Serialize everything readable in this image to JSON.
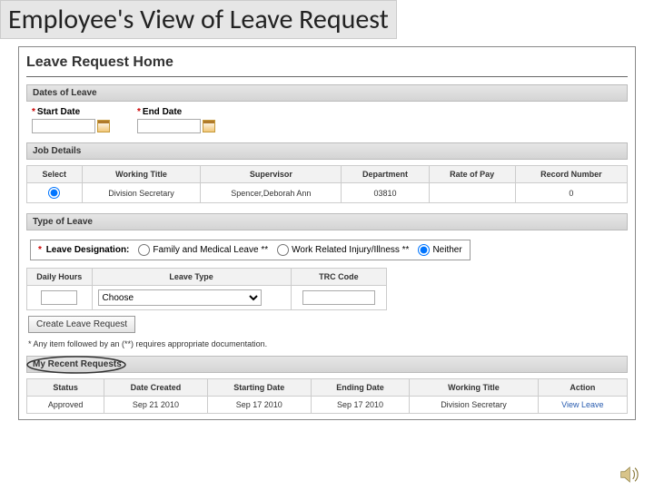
{
  "slide_title": "Employee's View of Leave Request",
  "page_heading": "Leave Request Home",
  "sections": {
    "dates": "Dates of Leave",
    "job": "Job Details",
    "type": "Type of Leave",
    "recent": "My Recent Requests"
  },
  "dates": {
    "start_label": "Start Date",
    "end_label": "End Date",
    "start_value": "",
    "end_value": ""
  },
  "job_table": {
    "headers": {
      "select": "Select",
      "title": "Working Title",
      "supervisor": "Supervisor",
      "dept": "Department",
      "rate": "Rate of Pay",
      "record": "Record Number"
    },
    "row": {
      "title": "Division Secretary",
      "supervisor": "Spencer,Deborah Ann",
      "dept": "03810",
      "rate": "",
      "record": "0"
    }
  },
  "designation": {
    "label": "Leave Designation:",
    "opt_fmla": "Family and Medical Leave **",
    "opt_work": "Work Related Injury/Illness **",
    "opt_neither": "Neither"
  },
  "leave_type_table": {
    "headers": {
      "hours": "Daily Hours",
      "type": "Leave Type",
      "trc": "TRC Code"
    },
    "row": {
      "hours": "",
      "type_selected": "Choose",
      "trc": ""
    }
  },
  "create_button": "Create Leave Request",
  "footnote": "* Any item followed by an (**) requires appropriate documentation.",
  "recent_table": {
    "headers": {
      "status": "Status",
      "created": "Date Created",
      "start": "Starting Date",
      "end": "Ending Date",
      "title": "Working Title",
      "action": "Action"
    },
    "row": {
      "status": "Approved",
      "created": "Sep 21 2010",
      "start": "Sep 17 2010",
      "end": "Sep 17 2010",
      "title": "Division Secretary",
      "action": "View Leave"
    }
  }
}
